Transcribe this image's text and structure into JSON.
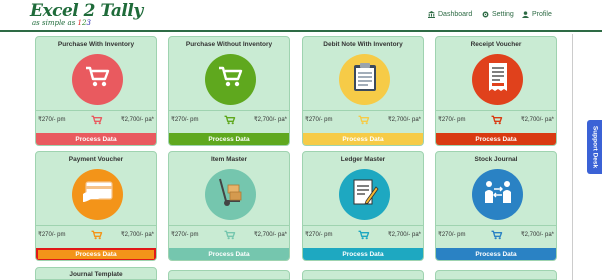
{
  "brand": {
    "name": "Excel 2 Tally",
    "tagline_prefix": "as simple as",
    "n1": "1",
    "n2": "2",
    "n3": "3"
  },
  "nav": [
    {
      "label": "Dashboard",
      "icon": "bank-icon"
    },
    {
      "label": "Setting",
      "icon": "gear-icon"
    },
    {
      "label": "Profile",
      "icon": "user-icon"
    }
  ],
  "support_label": "Support Desk",
  "cards": [
    {
      "title": "Purchase With Inventory",
      "icon": "cart-icon",
      "circle_color": "#e95a5f",
      "accent": "#e95a5f",
      "price_left": "₹270/- pm",
      "price_right": "₹2,700/- pa*",
      "button": "Process Data"
    },
    {
      "title": "Purchase Without Inventory",
      "icon": "cart-icon",
      "circle_color": "#5fa81e",
      "accent": "#5fa81e",
      "price_left": "₹270/- pm",
      "price_right": "₹2,700/- pa*",
      "button": "Process Data"
    },
    {
      "title": "Debit Note With Inventory",
      "icon": "clipboard-icon",
      "circle_color": "#f6cb47",
      "accent": "#f6cb47",
      "price_left": "₹270/- pm",
      "price_right": "₹2,700/- pa*",
      "button": "Process Data"
    },
    {
      "title": "Receipt Voucher",
      "icon": "receipt-icon",
      "circle_color": "#e0411c",
      "accent": "#d93a12",
      "price_left": "₹270/- pm",
      "price_right": "₹2,700/- pa*",
      "button": "Process Data"
    },
    {
      "title": "Payment Voucher",
      "icon": "credit-card-icon",
      "circle_color": "#f39419",
      "accent": "#f39419",
      "price_left": "₹270/- pm",
      "price_right": "₹2,700/- pa*",
      "button": "Process Data"
    },
    {
      "title": "Item Master",
      "icon": "hand-truck-icon",
      "circle_color": "#75c6ae",
      "accent": "#75c6ae",
      "price_left": "₹270/- pm",
      "price_right": "₹2,700/- pa*",
      "button": "Process Data"
    },
    {
      "title": "Ledger Master",
      "icon": "pen-document-icon",
      "circle_color": "#1ea8c1",
      "accent": "#1ea8c1",
      "price_left": "₹270/- pm",
      "price_right": "₹2,700/- pa*",
      "button": "Process Data"
    },
    {
      "title": "Stock Journal",
      "icon": "people-exchange-icon",
      "circle_color": "#2a82c4",
      "accent": "#2a82c4",
      "price_left": "₹270/- pm",
      "price_right": "₹2,700/- pa*",
      "button": "Process Data"
    }
  ],
  "stubs": [
    {
      "title": "Journal Template"
    }
  ]
}
